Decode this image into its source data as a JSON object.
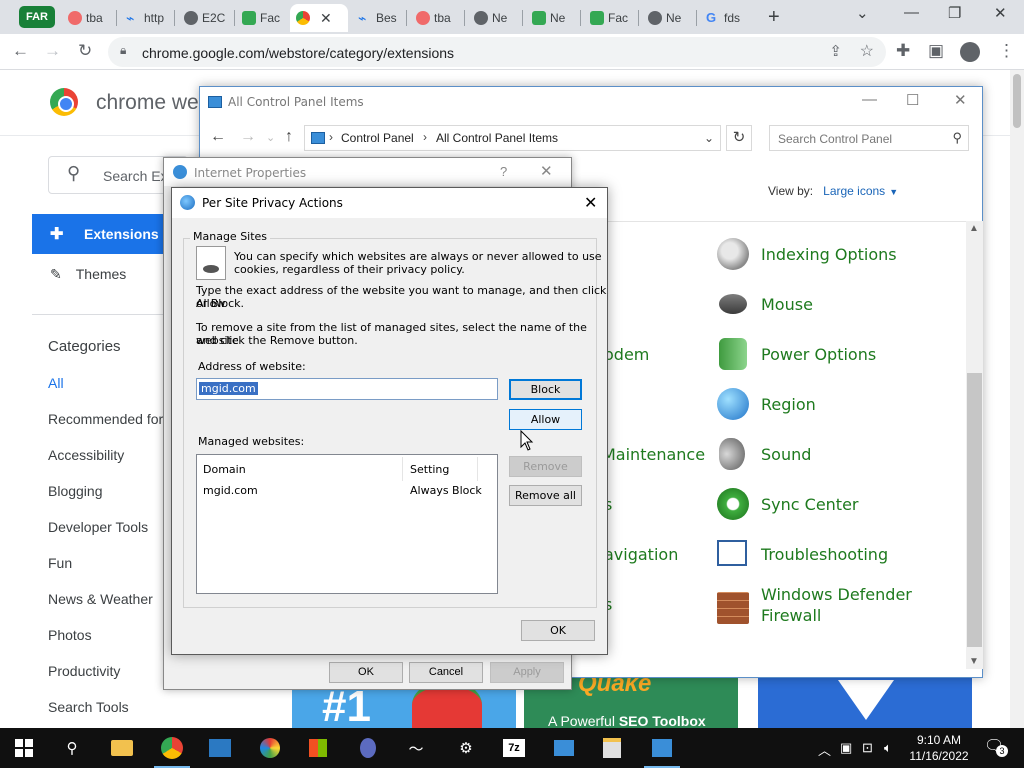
{
  "browser": {
    "profile_badge": "FAR",
    "tabs": [
      {
        "label": "tba",
        "favicon": "asana-icon",
        "color": "#f06a6a"
      },
      {
        "label": "http",
        "favicon": "link-icon",
        "color": "#1a73e8"
      },
      {
        "label": "E2C",
        "favicon": "globe-icon",
        "color": "#5f6368"
      },
      {
        "label": "Fac",
        "favicon": "meet-icon",
        "color": "#34a853"
      },
      {
        "label": "",
        "favicon": "webstore-icon",
        "color": "#ea4335",
        "active": true
      },
      {
        "label": "Bes",
        "favicon": "link-icon",
        "color": "#1a73e8"
      },
      {
        "label": "tba",
        "favicon": "asana-icon",
        "color": "#f06a6a"
      },
      {
        "label": "Ne",
        "favicon": "globe-icon",
        "color": "#5f6368"
      },
      {
        "label": "Ne",
        "favicon": "meet-icon",
        "color": "#34a853"
      },
      {
        "label": "Fac",
        "favicon": "meet-icon",
        "color": "#34a853"
      },
      {
        "label": "Ne",
        "favicon": "shield-icon",
        "color": "#5f6368"
      },
      {
        "label": "fds",
        "favicon": "google-icon",
        "color": "#4285f4"
      }
    ],
    "url": "chrome.google.com/webstore/category/extensions"
  },
  "webstore": {
    "title": "chrome we",
    "search_placeholder": "Search Ex",
    "nav_extensions": "Extensions",
    "nav_themes": "Themes",
    "categories_title": "Categories",
    "categories": [
      "All",
      "Recommended for",
      "Accessibility",
      "Blogging",
      "Developer Tools",
      "Fun",
      "News & Weather",
      "Photos",
      "Productivity",
      "Search Tools"
    ],
    "banner_1_text": "#1",
    "banner_2_title": "Quake",
    "banner_2_text_a": "A Powerful ",
    "banner_2_text_b": "SEO Toolbox"
  },
  "control_panel": {
    "window_title": "All Control Panel Items",
    "breadcrumb": [
      "Control Panel",
      "All Control Panel Items"
    ],
    "search_placeholder": "Search Control Panel",
    "view_by_label": "View by:",
    "view_by_value": "Large icons",
    "left_items": [
      "odem",
      "Maintenance",
      "s",
      "avigation",
      "s"
    ],
    "right_items": [
      "Indexing Options",
      "Mouse",
      "Power Options",
      "Region",
      "Sound",
      "Sync Center",
      "Troubleshooting",
      "Windows Defender Firewall"
    ]
  },
  "internet_properties": {
    "title": "Internet Properties",
    "help": "?",
    "ok": "OK",
    "cancel": "Cancel",
    "apply": "Apply"
  },
  "per_site": {
    "title": "Per Site Privacy Actions",
    "group_label": "Manage Sites",
    "intro_line1": "You can specify which websites are always or never allowed to use",
    "intro_line2": "cookies, regardless of their privacy policy.",
    "instr1_line1": "Type the exact address of the website you want to manage, and then click Allow",
    "instr1_line2": "or Block.",
    "instr2_line1": "To remove a site from the list of managed sites, select the name of the website",
    "instr2_line2": "and click the Remove button.",
    "address_label": "Address of website:",
    "address_value": "mgid.com",
    "block": "Block",
    "allow": "Allow",
    "managed_label": "Managed websites:",
    "col_domain": "Domain",
    "col_setting": "Setting",
    "rows": [
      {
        "domain": "mgid.com",
        "setting": "Always Block"
      }
    ],
    "remove": "Remove",
    "remove_all": "Remove all",
    "ok": "OK"
  },
  "taskbar": {
    "time": "9:10 AM",
    "date": "11/16/2022",
    "notification_count": "3",
    "seven_zip": "7z"
  }
}
